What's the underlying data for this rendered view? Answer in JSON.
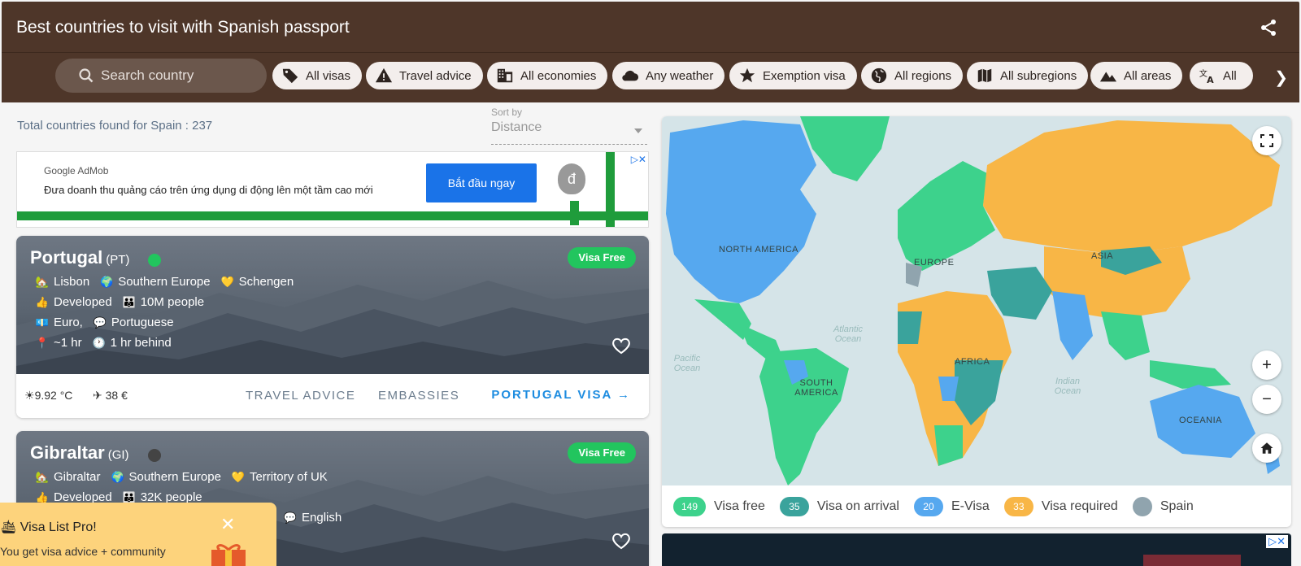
{
  "header": {
    "title": "Best countries to visit with Spanish passport"
  },
  "filters": {
    "search_placeholder": "Search country",
    "chips": [
      {
        "label": "All visas",
        "icon": "tag-icon"
      },
      {
        "label": "Travel advice",
        "icon": "warning-icon"
      },
      {
        "label": "All economies",
        "icon": "building-icon"
      },
      {
        "label": "Any weather",
        "icon": "cloud-icon"
      },
      {
        "label": "Exemption visa",
        "icon": "star-icon"
      },
      {
        "label": "All regions",
        "icon": "globe-icon"
      },
      {
        "label": "All subregions",
        "icon": "map-icon"
      },
      {
        "label": "All areas",
        "icon": "mountain-icon"
      },
      {
        "label": "All",
        "icon": "translate-icon"
      }
    ]
  },
  "results": {
    "total_text": "Total countries found for Spain : 237",
    "sort_label": "Sort by",
    "sort_value": "Distance"
  },
  "ad": {
    "brand": "Google AdMob",
    "text": "Đưa doanh thu quảng cáo trên ứng dụng di động lên một tầm cao mới",
    "cta": "Bắt đầu ngay",
    "bag_symbol": "đ"
  },
  "cards": [
    {
      "name": "Portugal",
      "code": "(PT)",
      "dot_color": "#22c55e",
      "badge": "Visa Free",
      "capital": "Lisbon",
      "region": "Southern Europe",
      "group": "Schengen",
      "economy": "Developed",
      "population": "10M people",
      "currency": "Euro,",
      "language": "Portuguese",
      "distance": "~1 hr",
      "time": "1 hr behind",
      "temp": "9.92 °C",
      "flight": "38 €",
      "travel_advice": "TRAVEL ADVICE",
      "embassies": "EMBASSIES",
      "visa_link": "PORTUGAL VISA"
    },
    {
      "name": "Gibraltar",
      "code": "(GI)",
      "dot_color": "#444444",
      "badge": "Visa Free",
      "capital": "Gibraltar",
      "region": "Southern Europe",
      "group": "Territory of UK",
      "economy": "Developed",
      "population": "32K people",
      "language": "English"
    }
  ],
  "map": {
    "labels": {
      "north_america": "NORTH AMERICA",
      "south_america": "SOUTH AMERICA",
      "europe": "EUROPE",
      "asia": "ASIA",
      "africa": "AFRICA",
      "oceania": "OCEANIA",
      "atlantic": "Atlantic Ocean",
      "pacific": "Pacific Ocean",
      "indian": "Indian Ocean"
    },
    "controls": {
      "zoom_in": "+",
      "zoom_out": "−"
    },
    "legend": [
      {
        "count": "149",
        "label": "Visa free",
        "color": "#3dd28c"
      },
      {
        "count": "35",
        "label": "Visa on arrival",
        "color": "#3aa39c"
      },
      {
        "count": "20",
        "label": "E-Visa",
        "color": "#56a8ef"
      },
      {
        "count": "33",
        "label": "Visa required",
        "color": "#f8b646"
      },
      {
        "count": "",
        "label": "Spain",
        "color": "#90a4ae"
      }
    ]
  },
  "promo": {
    "title": "🛳 Visa List Pro!",
    "text": "You get visa advice + community",
    "close": "✕"
  }
}
